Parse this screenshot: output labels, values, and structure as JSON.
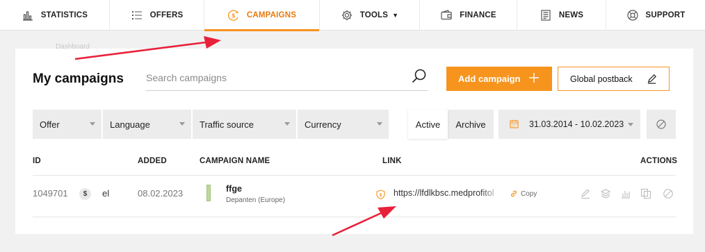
{
  "nav": {
    "items": [
      {
        "label": "STATISTICS",
        "icon": "bar-chart-icon"
      },
      {
        "label": "OFFERS",
        "icon": "list-icon"
      },
      {
        "label": "CAMPAIGNS",
        "icon": "campaign-coin-icon",
        "active": true
      },
      {
        "label": "TOOLS",
        "icon": "gear-icon",
        "caret": "▼"
      },
      {
        "label": "FINANCE",
        "icon": "wallet-icon"
      },
      {
        "label": "NEWS",
        "icon": "newspaper-icon"
      },
      {
        "label": "SUPPORT",
        "icon": "lifebuoy-icon"
      }
    ]
  },
  "ghost_text": "Dashboard",
  "page": {
    "title": "My campaigns",
    "search_placeholder": "Search campaigns",
    "add_button": "Add campaign",
    "postback_button": "Global postback"
  },
  "filters": {
    "offer": "Offer",
    "language": "Language",
    "traffic_source": "Traffic source",
    "currency": "Currency",
    "tabs": [
      "Active",
      "Archive"
    ],
    "active_tab": "Active",
    "date_range": "31.03.2014 - 10.02.2023"
  },
  "table": {
    "headers": {
      "id": "ID",
      "added": "ADDED",
      "name": "CAMPAIGN NAME",
      "link": "LINK",
      "actions": "ACTIONS"
    },
    "rows": [
      {
        "id": "1049701",
        "currency_badge": "$",
        "lang": "el",
        "added": "08.02.2023",
        "name": "ffge",
        "offer": "Depanten (Europe)",
        "link": "https://lfdlkbsc.medprofitol",
        "copy": "Copy",
        "actions": [
          "edit-icon",
          "layers-icon",
          "stats-icon",
          "duplicate-icon",
          "disable-icon"
        ]
      }
    ]
  },
  "colors": {
    "accent": "#f7941d",
    "annotation_arrow": "#e8213a",
    "background": "#f1f1f1"
  }
}
